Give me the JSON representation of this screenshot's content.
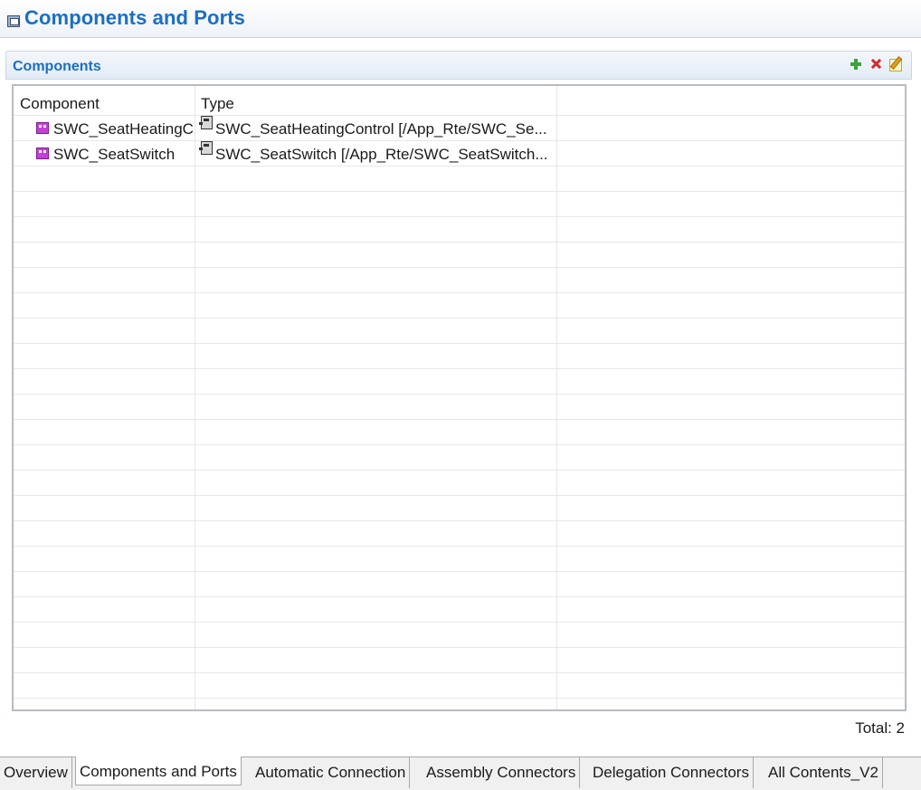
{
  "header": {
    "title": "Components and Ports",
    "icon": "component-view-icon"
  },
  "section": {
    "title": "Components",
    "toolbar": [
      {
        "name": "add",
        "icon": "add-icon"
      },
      {
        "name": "remove",
        "icon": "delete-icon"
      },
      {
        "name": "edit",
        "icon": "edit-icon"
      }
    ]
  },
  "table": {
    "columns": [
      "Component",
      "Type"
    ],
    "rows": [
      {
        "component": "SWC_SeatHeatingC",
        "component_icon": "software-component-icon",
        "type": "SWC_SeatHeatingControl [/App_Rte/SWC_Se...",
        "type_icon": "component-type-icon"
      },
      {
        "component": "SWC_SeatSwitch",
        "component_icon": "software-component-icon",
        "type": "SWC_SeatSwitch [/App_Rte/SWC_SeatSwitch...",
        "type_icon": "component-type-icon"
      }
    ]
  },
  "footer": {
    "total": "Total: 2"
  },
  "tabs": [
    {
      "label": "Overview",
      "active": false
    },
    {
      "label": "Components and Ports",
      "active": true
    },
    {
      "label": "Automatic Connection",
      "active": false
    },
    {
      "label": "Assembly Connectors",
      "active": false
    },
    {
      "label": "Delegation Connectors",
      "active": false
    },
    {
      "label": "All Contents_V2",
      "active": false
    }
  ],
  "colors": {
    "title_blue": "#1b6fc4",
    "component_icon": "#c33fd6"
  }
}
